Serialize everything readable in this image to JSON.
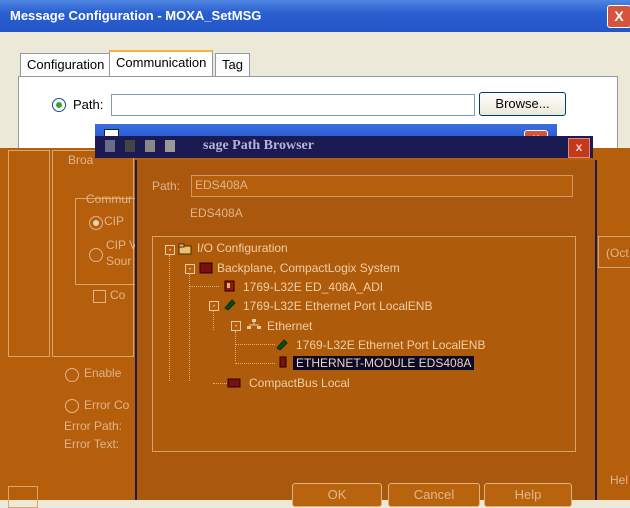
{
  "window": {
    "title": "Message Configuration - MOXA_SetMSG",
    "close": "X"
  },
  "tabs": [
    {
      "label": "Configuration"
    },
    {
      "label": "Communication"
    },
    {
      "label": "Tag"
    }
  ],
  "path_row": {
    "label": "Path:",
    "value": "",
    "browse": "Browse..."
  },
  "browser": {
    "title": "Message Path Browser",
    "title_visible": "sage Path Browser",
    "path_label": "Path:",
    "path_value": "EDS408A",
    "path_echo": "EDS408A",
    "tree": [
      "I/O Configuration",
      "Backplane, CompactLogix System",
      "1769-L32E ED_408A_ADI",
      "1769-L32E Ethernet Port LocalENB",
      "Ethernet",
      "1769-L32E Ethernet Port LocalENB",
      "ETHERNET-MODULE EDS408A",
      "CompactBus Local"
    ],
    "buttons": {
      "ok": "OK",
      "cancel": "Cancel",
      "help": "Help"
    }
  },
  "left_remnants": {
    "broadcast": "Broa",
    "communication": "Commur",
    "cip": "CIP",
    "cip2": "CIP V",
    "source": "Sour",
    "connected": "Co",
    "enable": "Enable",
    "error_code": "Error Co",
    "error_path": "Error Path:",
    "error_text": "Error Text:",
    "oct": "(Oct",
    "help_right": "Hel"
  }
}
